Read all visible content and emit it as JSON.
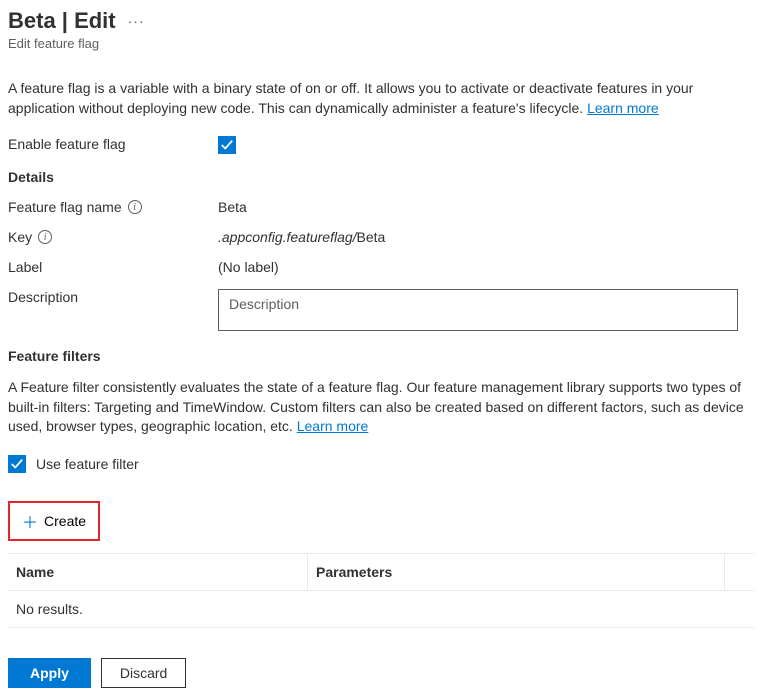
{
  "header": {
    "title": "Beta | Edit",
    "subtitle": "Edit feature flag"
  },
  "intro": {
    "text": "A feature flag is a variable with a binary state of on or off. It allows you to activate or deactivate features in your application without deploying new code. This can dynamically administer a feature's lifecycle.",
    "learn_more": "Learn more"
  },
  "enable": {
    "label": "Enable feature flag",
    "checked": true
  },
  "details": {
    "heading": "Details",
    "name_label": "Feature flag name",
    "name_value": "Beta",
    "key_label": "Key",
    "key_prefix": ".appconfig.featureflag/",
    "key_value": "Beta",
    "label_label": "Label",
    "label_value": "(No label)",
    "description_label": "Description",
    "description_placeholder": "Description",
    "description_value": ""
  },
  "filters": {
    "heading": "Feature filters",
    "text": "A Feature filter consistently evaluates the state of a feature flag. Our feature management library supports two types of built-in filters: Targeting and TimeWindow. Custom filters can also be created based on different factors, such as device used, browser types, geographic location, etc.",
    "learn_more": "Learn more",
    "use_label": "Use feature filter",
    "use_checked": true,
    "create_label": "Create",
    "table": {
      "col_name": "Name",
      "col_params": "Parameters",
      "empty": "No results."
    }
  },
  "footer": {
    "apply": "Apply",
    "discard": "Discard"
  }
}
